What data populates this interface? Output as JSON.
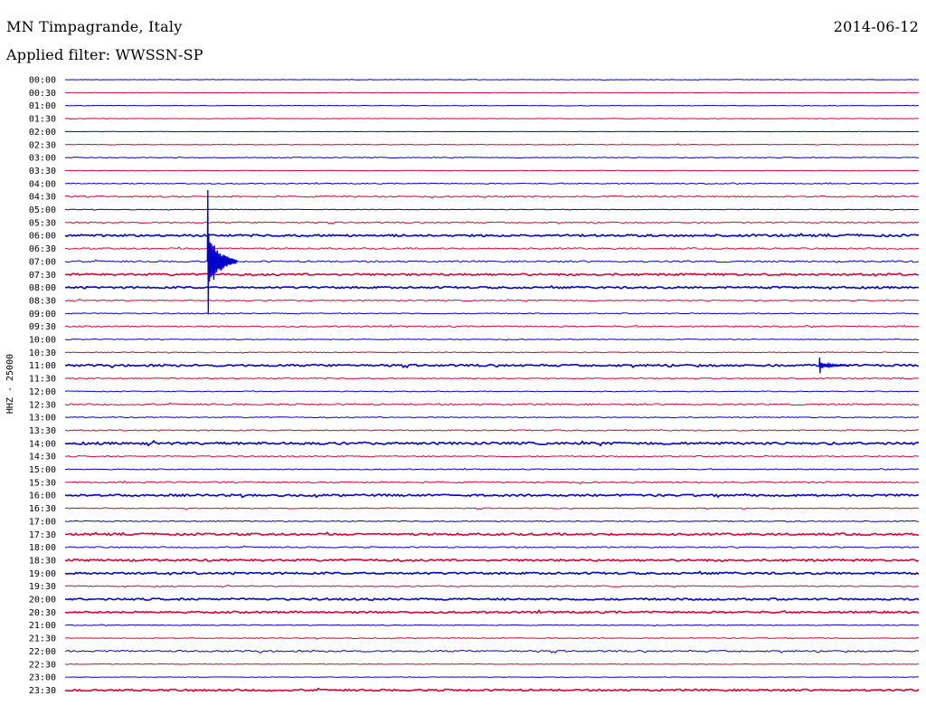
{
  "header": {
    "station_title": "MN Timpagrande, Italy",
    "date": "2014-06-12",
    "filter_label": "Applied filter: WWSSN-SP"
  },
  "chart_data": {
    "type": "line",
    "title": "MN Timpagrande, Italy",
    "ylabel": "HHZ - 25000",
    "trace_colors": [
      "#0000cc",
      "#dd0033"
    ],
    "row_labels": [
      "00:00",
      "00:30",
      "01:00",
      "01:30",
      "02:00",
      "02:30",
      "03:00",
      "03:30",
      "04:00",
      "04:30",
      "05:00",
      "05:30",
      "06:00",
      "06:30",
      "07:00",
      "07:30",
      "08:00",
      "08:30",
      "09:00",
      "09:30",
      "10:00",
      "10:30",
      "11:00",
      "11:30",
      "12:00",
      "12:30",
      "13:00",
      "13:30",
      "14:00",
      "14:30",
      "15:00",
      "15:30",
      "16:00",
      "16:30",
      "17:00",
      "17:30",
      "18:00",
      "18:30",
      "19:00",
      "19:30",
      "20:00",
      "20:30",
      "21:00",
      "21:30",
      "22:00",
      "22:30",
      "23:00",
      "23:30"
    ],
    "row_noise_level": [
      0.3,
      0.2,
      0.3,
      0.3,
      0.2,
      0.4,
      0.5,
      0.3,
      0.6,
      0.9,
      0.4,
      0.8,
      1.3,
      0.9,
      1.0,
      1.2,
      1.1,
      0.7,
      0.6,
      0.8,
      0.5,
      0.5,
      1.2,
      0.7,
      0.5,
      1.0,
      0.6,
      0.7,
      1.4,
      0.7,
      0.6,
      0.9,
      1.2,
      0.6,
      0.6,
      1.2,
      0.8,
      1.2,
      1.2,
      0.7,
      1.1,
      1.1,
      0.5,
      0.5,
      1.0,
      0.4,
      0.3,
      1.1
    ],
    "events": [
      {
        "row": "07:00",
        "minute": 5.0,
        "amplitude_up": 5.5,
        "amplitude_down": 4.0,
        "kind": "earthquake"
      },
      {
        "row": "11:00",
        "minute": 26.5,
        "amplitude_up": 0.6,
        "amplitude_down": 0.6,
        "kind": "local event"
      }
    ]
  }
}
